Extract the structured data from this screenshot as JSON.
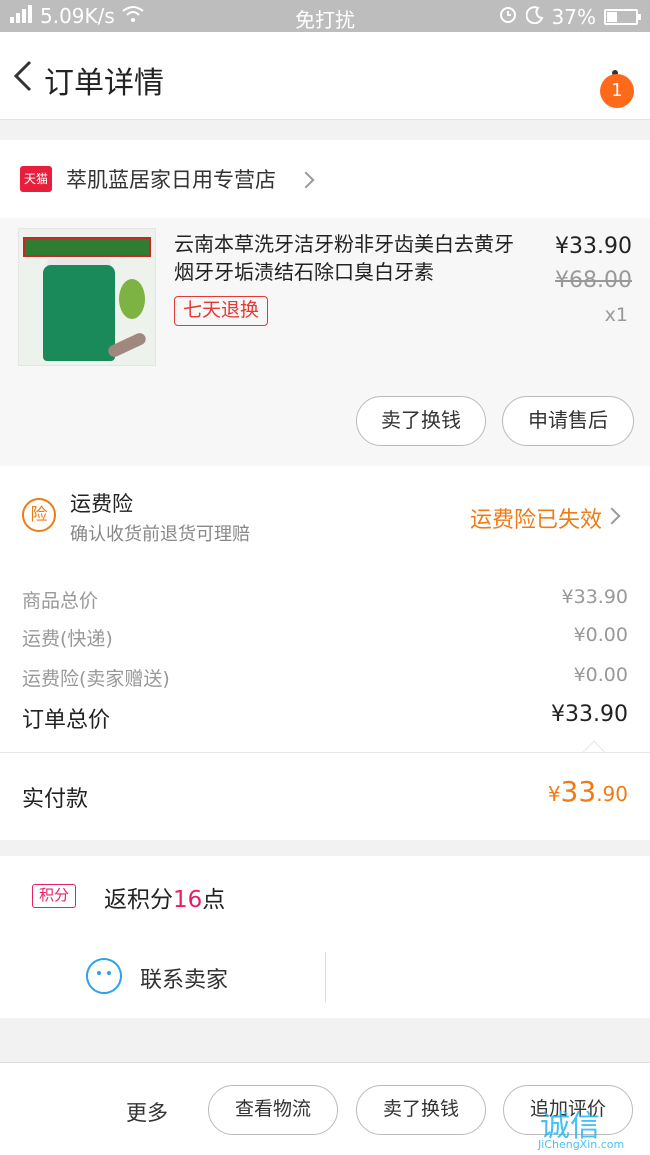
{
  "status_bar": {
    "speed": "5.09K/s",
    "center": "免打扰",
    "battery": "37%",
    "battery_level": 0.37
  },
  "header": {
    "title": "订单详情",
    "badge": "1"
  },
  "store": {
    "icon_label": "天猫",
    "name": "萃肌蓝居家日用专营店"
  },
  "product": {
    "title": "云南本草洗牙洁牙粉非牙齿美白去黄牙烟牙牙垢渍结石除口臭白牙素",
    "tag": "七天退换",
    "price": "¥33.90",
    "original_price": "¥68.00",
    "quantity": "x1",
    "buttons": {
      "sell": "卖了换钱",
      "after_sale": "申请售后"
    }
  },
  "insurance": {
    "icon_label": "险",
    "title": "运费险",
    "subtitle": "确认收货前退货可理赔",
    "status": "运费险已失效"
  },
  "summary": {
    "rows": [
      {
        "label": "商品总价",
        "value": "¥33.90"
      },
      {
        "label": "运费(快递)",
        "value": "¥0.00"
      },
      {
        "label": "运费险(卖家赠送)",
        "value": "¥0.00"
      }
    ],
    "total_label": "订单总价",
    "total_value": "¥33.90",
    "paid_label": "实付款",
    "paid_currency": "¥",
    "paid_integer": "33",
    "paid_decimal": ".90"
  },
  "points": {
    "icon_label": "积分",
    "text_before": "返积分",
    "number": "16",
    "text_after": "点"
  },
  "contact": {
    "label": "联系卖家"
  },
  "bottom_bar": {
    "more": "更多",
    "logistics": "查看物流",
    "sell": "卖了换钱",
    "review": "追加评价"
  },
  "watermark": {
    "text": "诚信",
    "url": "JiChengXin.com"
  },
  "colors": {
    "accent_orange": "#f07b14",
    "tmall_red": "#e91e3c",
    "points_pink": "#e91e63",
    "contact_blue": "#29a4e6"
  }
}
